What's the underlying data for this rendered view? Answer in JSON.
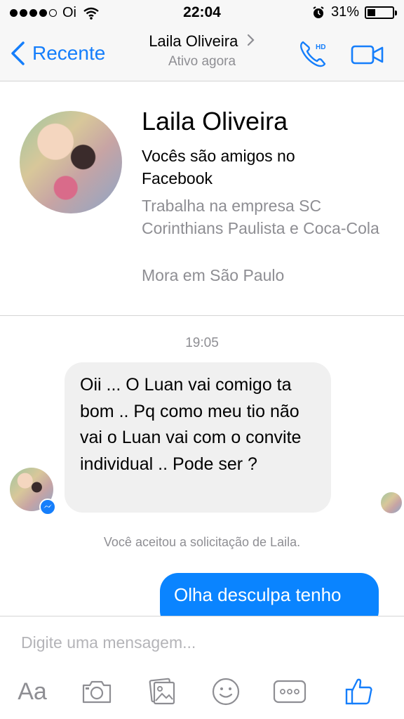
{
  "status_bar": {
    "carrier": "Oi",
    "time": "22:04",
    "battery_percent": "31%",
    "battery_level": 0.31,
    "signal_bars_filled": 4
  },
  "nav": {
    "back_label": "Recente",
    "title": "Laila Oliveira",
    "subtitle": "Ativo agora",
    "call_icon_badge": "HD"
  },
  "profile": {
    "name": "Laila Oliveira",
    "friends_text": "Vocês são amigos no Facebook",
    "work_text": "Trabalha na empresa SC Corinthians Paulista e Coca-Cola",
    "lives_text": "Mora em São Paulo"
  },
  "conversation": {
    "timestamp": "19:05",
    "incoming_message": "Oii ... O Luan vai comigo ta bom ..  Pq como meu tio não vai o Luan vai com o convite individual .. Pode ser ?",
    "system_note": "Você aceitou a solicitação de Laila.",
    "outgoing_message": "Olha desculpa tenho"
  },
  "composer": {
    "placeholder": "Digite uma mensagem...",
    "aa_label": "Aa"
  },
  "colors": {
    "accent": "#157efb",
    "outgoing_bubble": "#0a84ff",
    "incoming_bubble": "#f0f0f0",
    "secondary_text": "#8e8e93"
  },
  "icons": [
    "wifi-icon",
    "alarm-icon",
    "battery-icon",
    "chevron-left-icon",
    "chevron-right-icon",
    "phone-hd-icon",
    "video-camera-icon",
    "messenger-icon",
    "camera-icon",
    "gallery-icon",
    "emoji-icon",
    "more-icon",
    "thumbs-up-icon"
  ]
}
